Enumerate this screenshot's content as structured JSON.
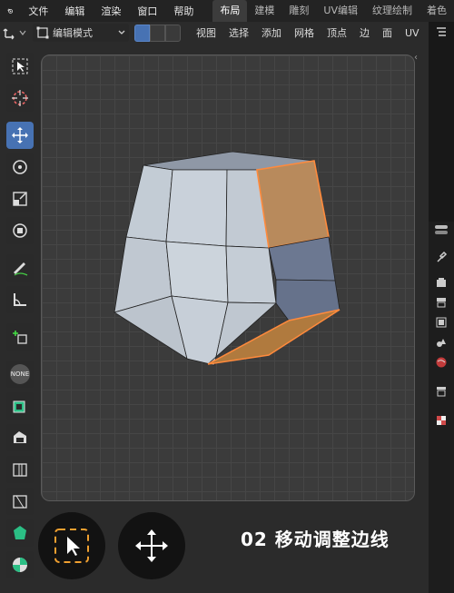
{
  "menubar": {
    "menus": [
      "文件",
      "编辑",
      "渲染",
      "窗口",
      "帮助"
    ],
    "workspace_tabs": [
      {
        "label": "布局",
        "active": true
      },
      {
        "label": "建模",
        "active": false
      },
      {
        "label": "雕刻",
        "active": false
      },
      {
        "label": "UV编辑",
        "active": false
      },
      {
        "label": "纹理绘制",
        "active": false
      },
      {
        "label": "着色",
        "active": false
      }
    ]
  },
  "header": {
    "mode": "编辑模式",
    "menus": [
      "视图",
      "选择",
      "添加",
      "网格",
      "顶点",
      "边",
      "面",
      "UV"
    ],
    "select_mode_active": "vertex"
  },
  "toolbar": {
    "tools": [
      "select-box",
      "cursor",
      "move",
      "rotate",
      "scale",
      "transform",
      "annotate",
      "measure",
      "add-cube",
      "none",
      "extrude",
      "inset",
      "bevel",
      "loop-cut",
      "knife",
      "poly-build",
      "spin"
    ],
    "active_tool": "move",
    "none_label": "NONE"
  },
  "bottom_overlay": {
    "caption": "02 移动调整边线"
  },
  "colors": {
    "accent": "#4772b3",
    "selected_edge": "#ff8a3c",
    "mesh_face": "#c5cdd6",
    "selected_face": "#b88a5c"
  }
}
